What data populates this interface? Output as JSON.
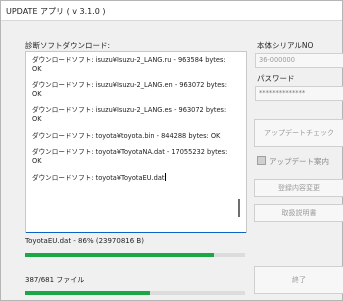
{
  "window": {
    "title": "UPDATE アプリ ( v 3.1.0 )"
  },
  "log": {
    "label": "診断ソフトダウンロード:",
    "entries": [
      "ダウンロードソフト: isuzu¥Isuzu-2_LANG.ru - 963584 bytes: OK",
      "ダウンロードソフト: isuzu¥Isuzu-2_LANG.en - 963072 bytes: OK",
      "ダウンロードソフト: isuzu¥Isuzu-2_LANG.es - 963072 bytes: OK",
      "ダウンロードソフト: toyota¥toyota.bin - 844288 bytes: OK",
      "ダウンロードソフト: toyota¥ToyotaNA.dat - 17055232 bytes: OK",
      "ダウンロードソフト: toyota¥ToyotaEU.dat"
    ]
  },
  "serial": {
    "label": "本体シリアルNO",
    "value": "36-000000"
  },
  "password": {
    "label": "パスワード",
    "value": "**************"
  },
  "buttons": {
    "update_check": "アップデートチェック",
    "update_guide": "アップデート案内",
    "registration": "登録内容変更",
    "manual": "取扱説明書",
    "exit": "終了"
  },
  "progress_file": {
    "text": "ToyotaEU.dat - 86% (23970816 B)",
    "fraction": 0.86
  },
  "progress_total": {
    "text": "387/681 ファイル",
    "fraction": 0.568
  },
  "colors": {
    "progress_fill": "#1aa844",
    "focus": "#0a64c8"
  }
}
